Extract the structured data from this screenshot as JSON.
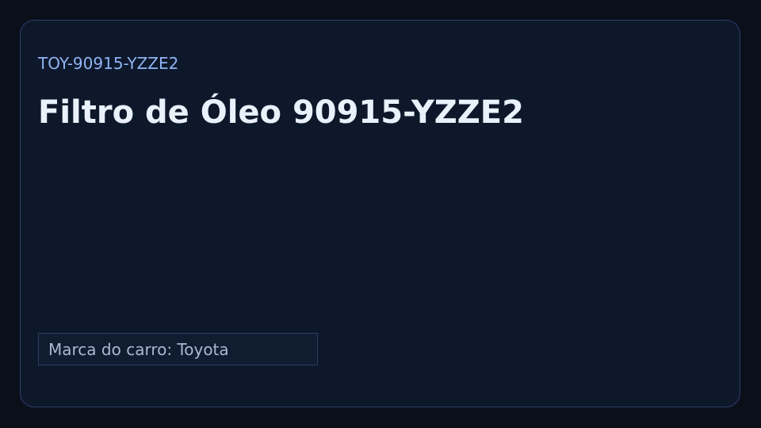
{
  "product": {
    "sku": "TOY-90915-YZZE2",
    "title": "Filtro de Óleo 90915-YZZE2",
    "brand_label": "Marca do carro: Toyota"
  },
  "colors": {
    "background": "#0a0f1a",
    "card": "#0e182b",
    "border": "#2a3f66",
    "accent": "#8fb4f3",
    "title": "#e9f1fb",
    "muted": "#a9b9d0"
  }
}
